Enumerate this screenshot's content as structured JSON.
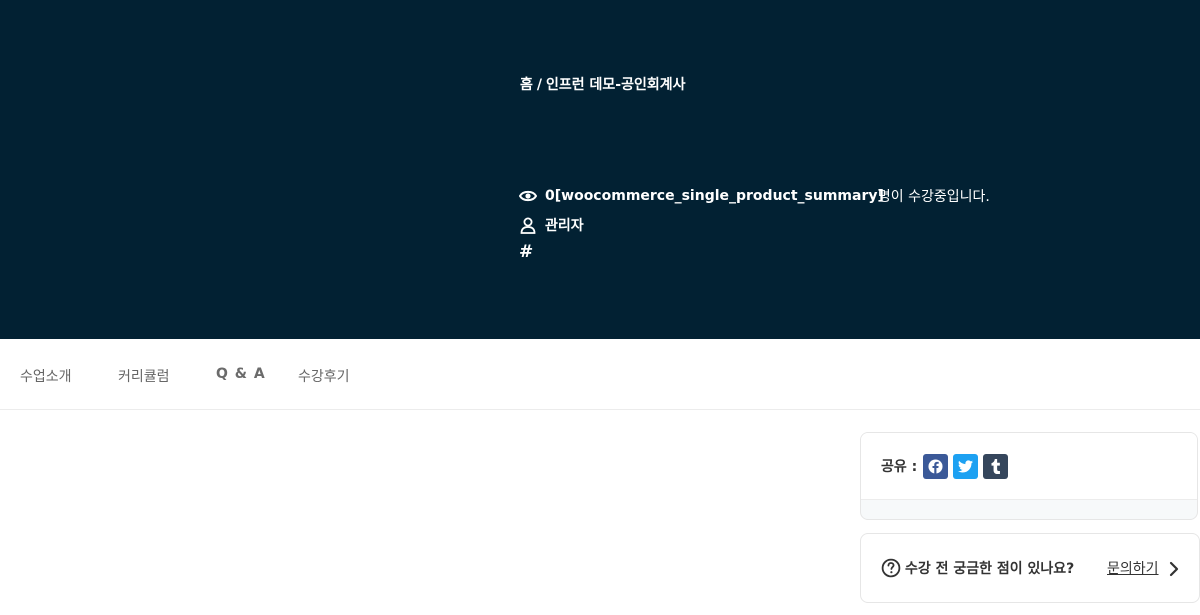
{
  "breadcrumb": {
    "home": "홈",
    "separator": "/",
    "current": "인프런 데모-공인회계사"
  },
  "meta": {
    "views_icon": "eye-icon",
    "views_count": "0[woocommerce_single_product_summary]",
    "views_suffix": "명이 수강중입니다.",
    "author_icon": "user-icon",
    "author": "관리자",
    "tags_icon": "hash-icon",
    "tags_symbol": "#"
  },
  "tabs": [
    "수업소개",
    "커리큘럼",
    "Q & A",
    "수강후기"
  ],
  "share": {
    "label": "공유 :",
    "buttons": [
      "facebook-icon",
      "twitter-icon",
      "tumblr-icon"
    ],
    "colors": {
      "facebook": "#3b5998",
      "twitter": "#1da1f2",
      "tumblr": "#35465c"
    }
  },
  "ask": {
    "icon": "question-circle-icon",
    "text": "수강 전 궁금한 점이 있나요?",
    "link": "문의하기",
    "chevron": "chevron-right-icon"
  },
  "colors": {
    "hero_bg": "#022133",
    "text_light": "#ffffff",
    "tab_text": "#666666"
  }
}
